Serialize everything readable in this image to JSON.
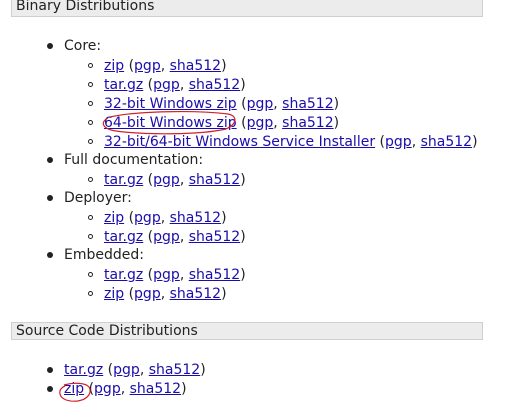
{
  "sections": {
    "binary": {
      "title": "Binary Distributions",
      "groups": [
        {
          "label": "Core:",
          "items": [
            {
              "main": "zip",
              "pgp": "pgp",
              "sha": "sha512"
            },
            {
              "main": "tar.gz",
              "pgp": "pgp",
              "sha": "sha512"
            },
            {
              "main": "32-bit Windows zip",
              "pgp": "pgp",
              "sha": "sha512"
            },
            {
              "main": "64-bit Windows zip",
              "pgp": "pgp",
              "sha": "sha512"
            },
            {
              "main": "32-bit/64-bit Windows Service Installer",
              "pgp": "pgp",
              "sha": "sha512"
            }
          ]
        },
        {
          "label": "Full documentation:",
          "items": [
            {
              "main": "tar.gz",
              "pgp": "pgp",
              "sha": "sha512"
            }
          ]
        },
        {
          "label": "Deployer:",
          "items": [
            {
              "main": "zip",
              "pgp": "pgp",
              "sha": "sha512"
            },
            {
              "main": "tar.gz",
              "pgp": "pgp",
              "sha": "sha512"
            }
          ]
        },
        {
          "label": "Embedded:",
          "items": [
            {
              "main": "tar.gz",
              "pgp": "pgp",
              "sha": "sha512"
            },
            {
              "main": "zip",
              "pgp": "pgp",
              "sha": "sha512"
            }
          ]
        }
      ]
    },
    "source": {
      "title": "Source Code Distributions",
      "items": [
        {
          "main": "tar.gz",
          "pgp": "pgp",
          "sha": "sha512"
        },
        {
          "main": "zip",
          "pgp": "pgp",
          "sha": "sha512"
        }
      ]
    }
  },
  "punct": {
    "open": " (",
    "comma": ", ",
    "close": ")"
  },
  "colors": {
    "link": "#1a0dab",
    "annotation": "#d0202a",
    "header_bg": "#ececec"
  }
}
